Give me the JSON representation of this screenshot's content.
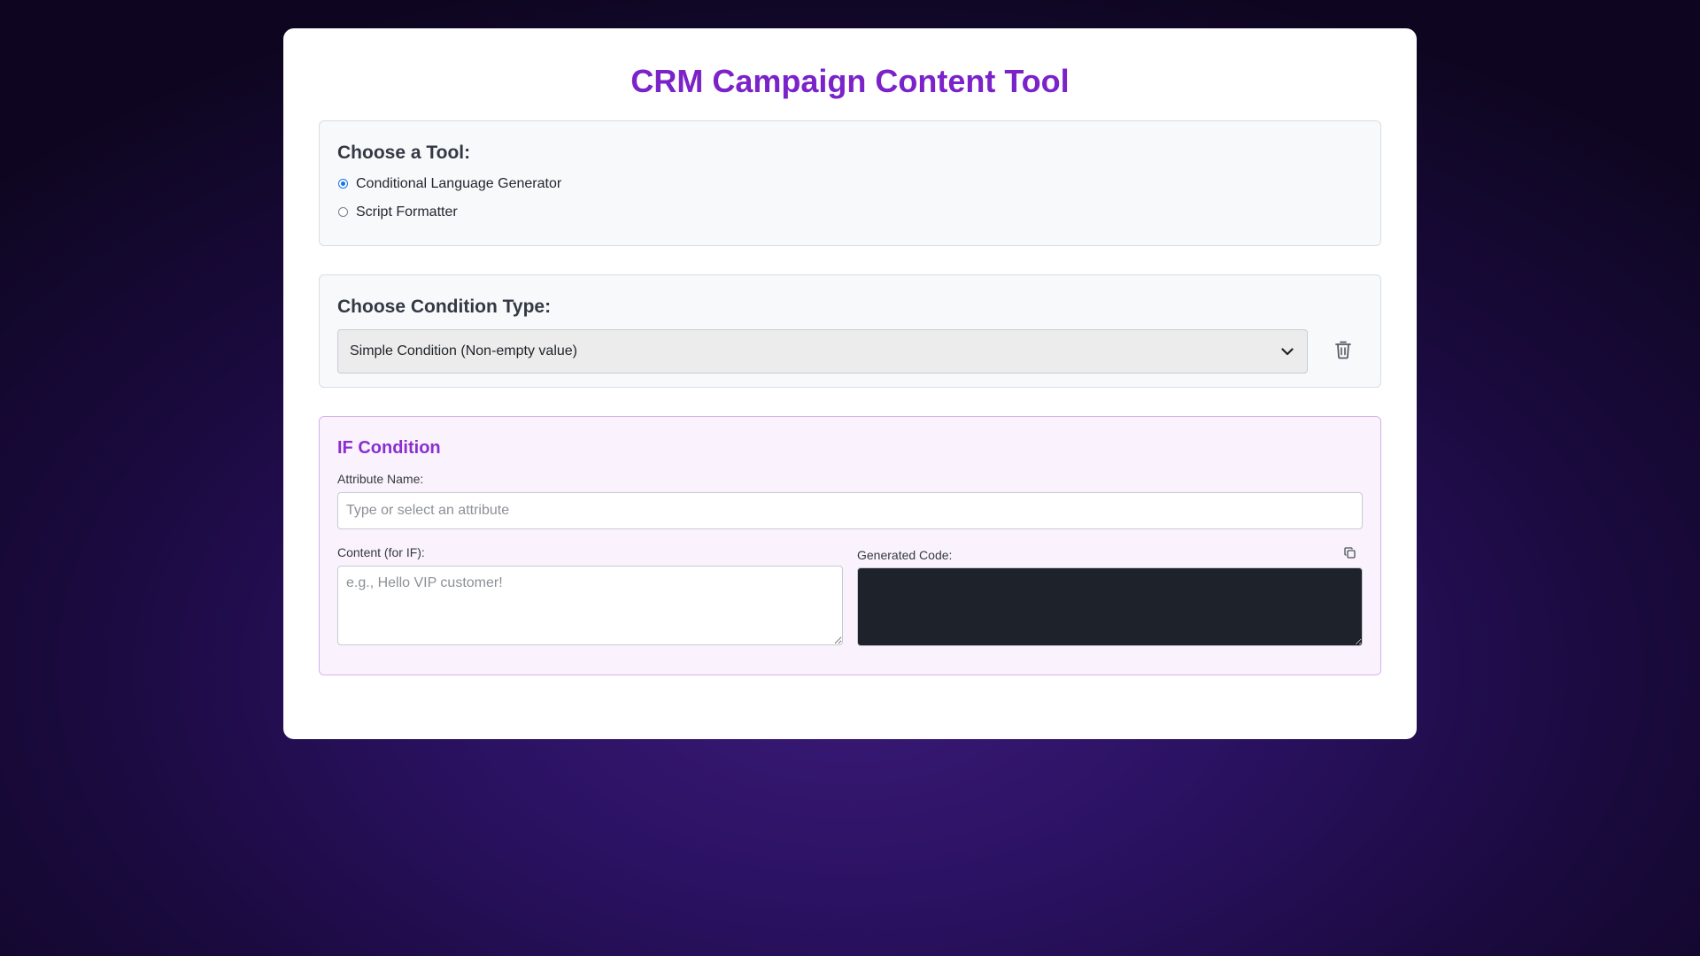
{
  "page_title": "CRM Campaign Content Tool",
  "tool_panel": {
    "heading": "Choose a Tool:",
    "options": [
      {
        "label": "Conditional Language Generator",
        "checked": true
      },
      {
        "label": "Script Formatter",
        "checked": false
      }
    ]
  },
  "condition_panel": {
    "heading": "Choose Condition Type:",
    "selected_value": "Simple Condition (Non-empty value)",
    "chevron_icon": "chevron-down-icon",
    "delete_icon": "trash-icon"
  },
  "if_panel": {
    "heading": "IF Condition",
    "attribute_label": "Attribute Name:",
    "attribute_value": "",
    "attribute_placeholder": "Type or select an attribute",
    "content_label": "Content (for IF):",
    "content_value": "",
    "content_placeholder": "e.g., Hello VIP customer!",
    "code_label": "Generated Code:",
    "code_value": "",
    "copy_icon": "copy-icon"
  },
  "colors": {
    "accent": "#7b22c9",
    "if_heading": "#8a2ed0",
    "radio_checked": "#1a73e8",
    "code_background": "#1e222b"
  }
}
